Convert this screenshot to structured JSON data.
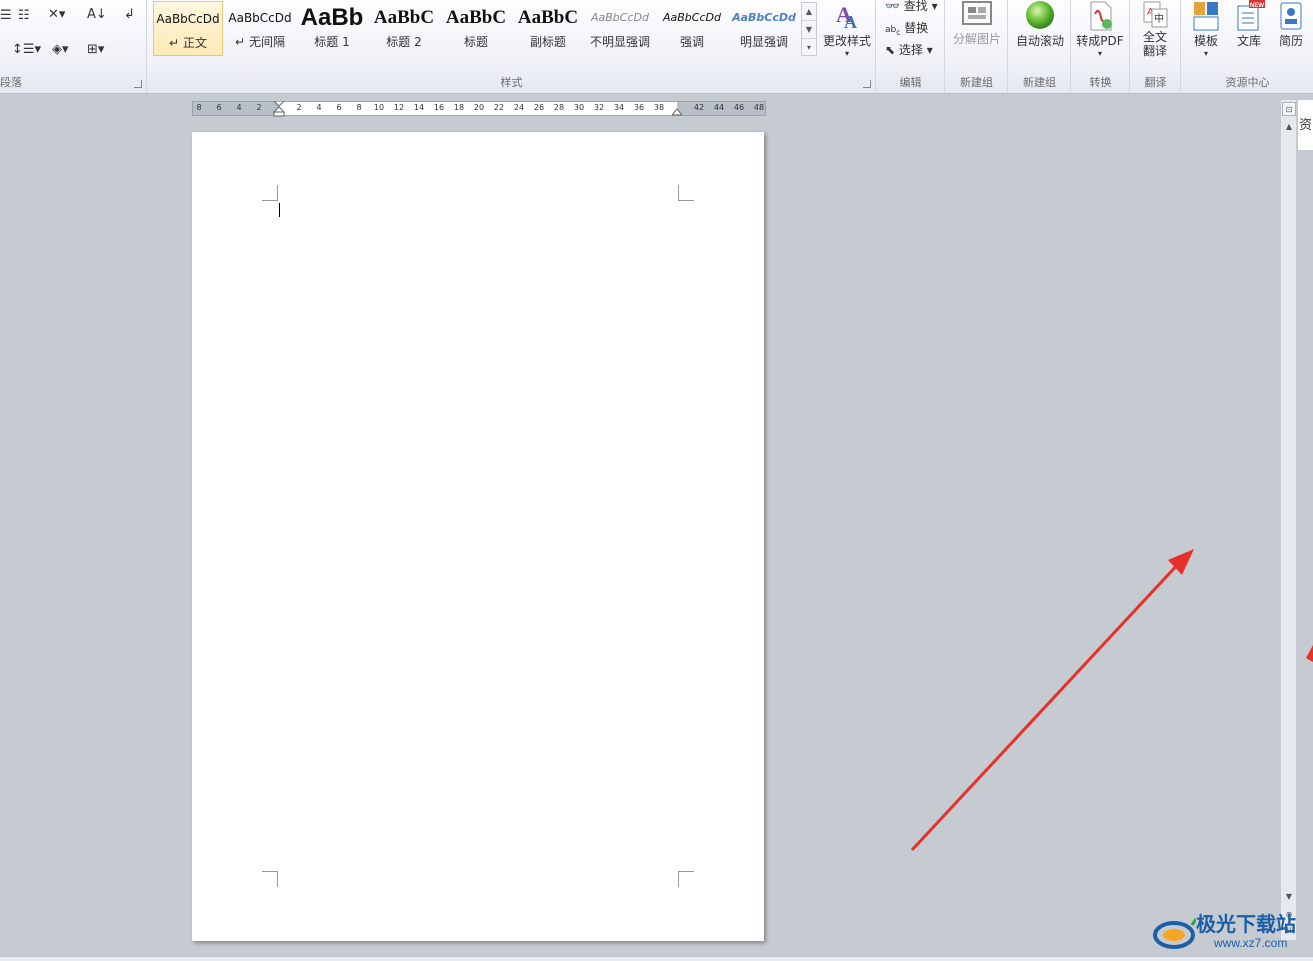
{
  "ribbon": {
    "paragraph_group": {
      "label": "段落"
    },
    "styles_group": {
      "label": "样式",
      "styles": [
        {
          "sample": "AaBbCcDd",
          "name": "正文",
          "mark": "↵",
          "selected": true
        },
        {
          "sample": "AaBbCcDd",
          "name": "无间隔",
          "mark": "↵"
        },
        {
          "sample": "AaBb",
          "name": "标题 1"
        },
        {
          "sample": "AaBbC",
          "name": "标题 2"
        },
        {
          "sample": "AaBbC",
          "name": "标题"
        },
        {
          "sample": "AaBbC",
          "name": "副标题"
        },
        {
          "sample": "AaBbCcDd",
          "name": "不明显强调"
        },
        {
          "sample": "AaBbCcDd",
          "name": "强调"
        },
        {
          "sample": "AaBbCcDd",
          "name": "明显强调"
        }
      ],
      "change_styles": "更改样式"
    },
    "edit_group": {
      "label": "编辑",
      "find": "查找",
      "replace": "替换",
      "select": "选择"
    },
    "newgroup1": {
      "label": "新建组",
      "button": "分解图片"
    },
    "newgroup2": {
      "label": "新建组",
      "button": "自动滚动"
    },
    "convert_group": {
      "label": "转换",
      "button": "转成PDF"
    },
    "translate_group": {
      "label": "翻译",
      "button_line1": "全文",
      "button_line2": "翻译"
    },
    "resource_group": {
      "label": "资源中心",
      "template": "模板",
      "library": "文库",
      "resume": "简历",
      "new_badge": "NEW"
    }
  },
  "ruler": {
    "left_ticks": [
      "8",
      "6",
      "4",
      "2"
    ],
    "right_ticks": [
      "2",
      "4",
      "6",
      "8",
      "10",
      "12",
      "14",
      "16",
      "18",
      "20",
      "22",
      "24",
      "26",
      "28",
      "30",
      "32",
      "34",
      "36",
      "38",
      "42",
      "44",
      "46",
      "48"
    ]
  },
  "side_pane": {
    "label": "资"
  },
  "watermark": {
    "title": "极光下载站",
    "url": "www.xz7.com"
  },
  "colors": {
    "arrow": "#e8302a",
    "accent_selected": "#fde9b5",
    "watermark_blue": "#1b5fa8"
  }
}
